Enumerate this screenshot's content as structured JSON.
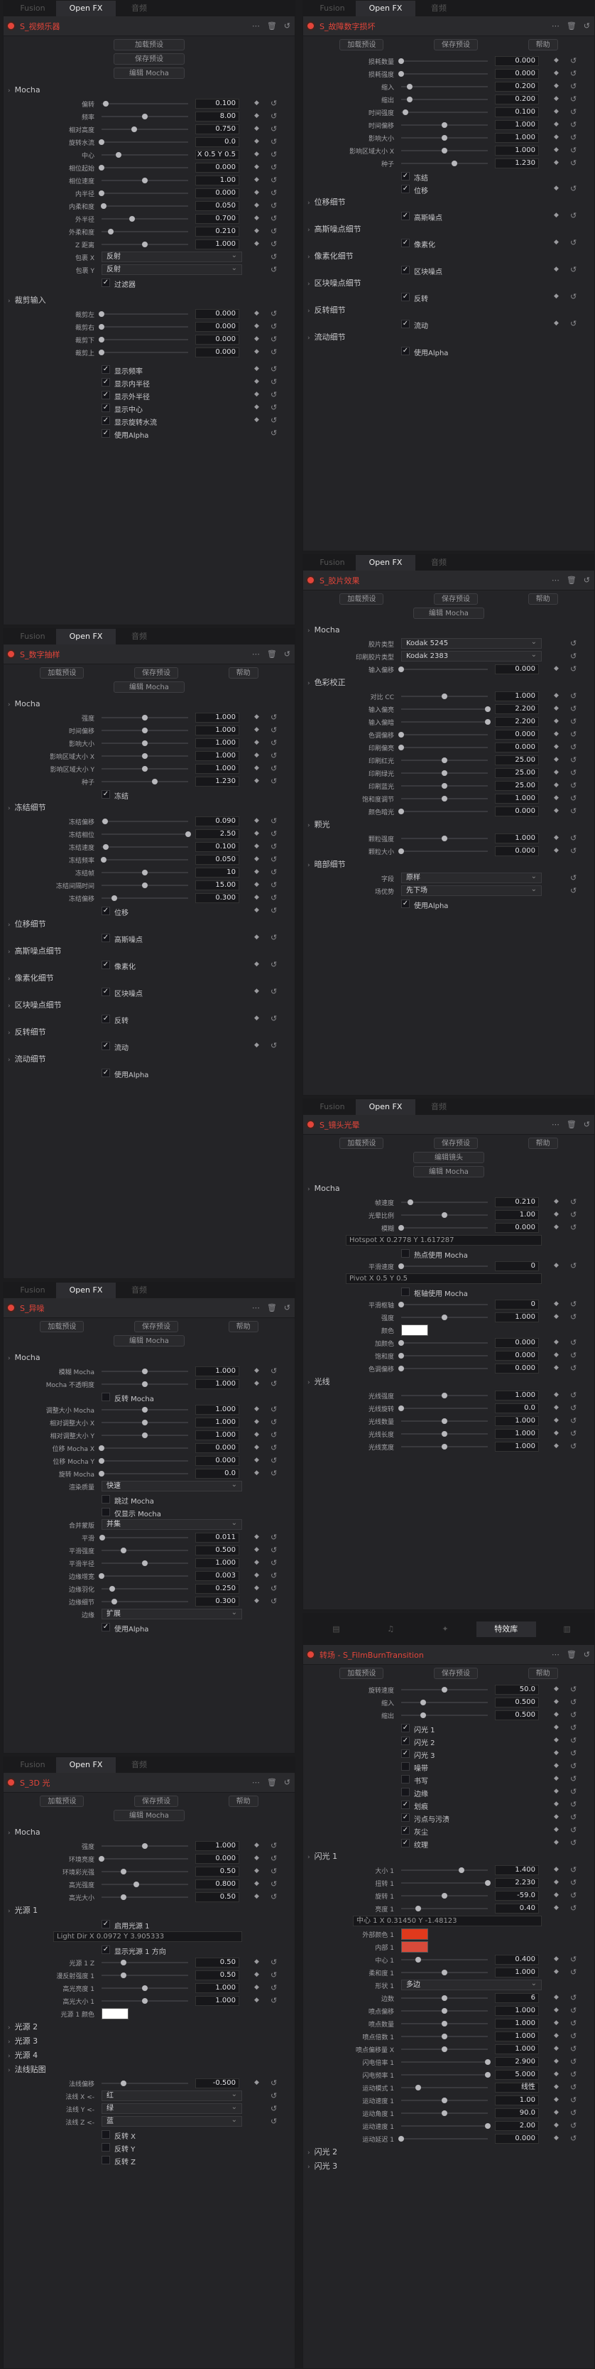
{
  "tab_fusion": "Fusion",
  "tab_openfx": "Open FX",
  "tab_other": "音频",
  "tab_effects": "特效库",
  "btn_load": "加载预设",
  "btn_save": "保存预设",
  "btn_help": "帮助",
  "btn_mocha": "编辑 Mocha",
  "btn_lens": "编辑镜头",
  "p1": {
    "title": "S_视频乐器",
    "secs": [
      "Mocha",
      "裁剪输入"
    ],
    "rows": [
      [
        "偏转",
        "0.100"
      ],
      [
        "频率",
        "8.00"
      ],
      [
        "相对高度",
        "0.750"
      ],
      [
        "旋转水流",
        "0.0"
      ],
      [
        "中心",
        "X 0.5   Y 0.5"
      ],
      [
        "相位起始",
        "0.000"
      ],
      [
        "相位速度",
        "1.00"
      ],
      [
        "内半径",
        "0.000"
      ],
      [
        "内柔和度",
        "0.050"
      ],
      [
        "外半径",
        "0.700"
      ],
      [
        "外柔和度",
        "0.210"
      ],
      [
        "Z 距离",
        "1.000"
      ]
    ],
    "drops": [
      [
        "包裹 X",
        "反射"
      ],
      [
        "包裹 Y",
        "反射"
      ]
    ],
    "filter": "过滤器",
    "crops": [
      [
        "裁剪左",
        "0.000"
      ],
      [
        "裁剪右",
        "0.000"
      ],
      [
        "裁剪下",
        "0.000"
      ],
      [
        "裁剪上",
        "0.000"
      ]
    ],
    "checks": [
      "显示频率",
      "显示内半径",
      "显示外半径",
      "显示中心",
      "显示旋转水流"
    ],
    "alpha": "使用Alpha"
  },
  "p2": {
    "title": "S_数字抽样",
    "rows": [
      [
        "强度",
        "1.000"
      ],
      [
        "时间偏移",
        "1.000"
      ],
      [
        "影响大小",
        "1.000"
      ],
      [
        "影响区域大小 X",
        "1.000"
      ],
      [
        "影响区域大小 Y",
        "1.000"
      ],
      [
        "种子",
        "1.230"
      ]
    ],
    "freeze": "冻结",
    "sec2": "冻结细节",
    "rows2": [
      [
        "冻结偏移",
        "0.090"
      ],
      [
        "冻结相位",
        "2.50"
      ],
      [
        "冻结速度",
        "0.100"
      ],
      [
        "冻结频率",
        "0.050"
      ],
      [
        "冻结帧",
        "10"
      ],
      [
        "冻结间隔时间",
        "15.00"
      ],
      [
        "冻结偏移",
        "0.300"
      ]
    ],
    "groups": [
      [
        "位移",
        "位移细节"
      ],
      [
        "高斯噪点",
        "高斯噪点细节"
      ],
      [
        "像素化",
        "像素化细节"
      ],
      [
        "区块噪点",
        "区块噪点细节"
      ],
      [
        "反转",
        "反转细节"
      ],
      [
        "流动",
        "流动细节"
      ]
    ],
    "alpha": "使用Alpha"
  },
  "p3": {
    "title": "S_异噪",
    "rows": [
      [
        "模糊 Mocha",
        "1.000"
      ],
      [
        "Mocha 不透明度",
        "1.000"
      ]
    ],
    "rev": "反转 Mocha",
    "rows2": [
      [
        "调整大小 Mocha",
        "1.000"
      ],
      [
        "相对调整大小 X",
        "1.000"
      ],
      [
        "相对调整大小 Y",
        "1.000"
      ],
      [
        "位移 Mocha X",
        "0.000"
      ],
      [
        "位移 Mocha Y",
        "0.000"
      ],
      [
        "旋转 Mocha",
        "0.0"
      ]
    ],
    "quality": [
      "渲染质量",
      "快速"
    ],
    "chk": [
      "跳过 Mocha",
      "仅显示 Mocha"
    ],
    "blend": [
      "合并蒙版",
      "并集"
    ],
    "rows3": [
      [
        "平滑",
        "0.011"
      ],
      [
        "平滑强度",
        "0.500"
      ],
      [
        "平滑半径",
        "1.000"
      ],
      [
        "边缘增宽",
        "0.003"
      ],
      [
        "边缘羽化",
        "0.250"
      ],
      [
        "边缘细节",
        "0.300"
      ]
    ],
    "edge": [
      "边缘",
      "扩展"
    ],
    "alpha": "使用Alpha"
  },
  "p4": {
    "title": "S_3D 光",
    "rows": [
      [
        "强度",
        "1.000"
      ],
      [
        "环境亮度",
        "0.000"
      ],
      [
        "环境彩光强",
        "0.50"
      ],
      [
        "高光强度",
        "0.800"
      ],
      [
        "高光大小",
        "0.50"
      ]
    ],
    "light": "光源 1",
    "enable": "启用光源 1",
    "dir": "Light Dir  X 0.0972   Y 3.905333",
    "show": "显示光源 1 方向",
    "rows2": [
      [
        "光源 1 Z",
        "0.50"
      ],
      [
        "漫反射强度 1",
        "0.50"
      ],
      [
        "高光亮度 1",
        "1.000"
      ],
      [
        "高光大小 1",
        "1.000"
      ]
    ],
    "color": "光源 1 颜色",
    "more": [
      "光源 2",
      "光源 3",
      "光源 4"
    ],
    "normal": "法线贴图",
    "nrows": [
      [
        "法线偏移",
        "-0.500"
      ]
    ],
    "ndd": [
      [
        "法线 X <-",
        "红"
      ],
      [
        "法线 Y <-",
        "绿"
      ],
      [
        "法线 Z <-",
        "蓝"
      ]
    ],
    "flips": [
      "反转 X",
      "反转 Y",
      "反转 Z"
    ]
  },
  "p5": {
    "title": "S_故障数字损坏",
    "rows": [
      [
        "损耗数量",
        "0.000"
      ],
      [
        "损耗强度",
        "0.000"
      ],
      [
        "缩入",
        "0.200"
      ],
      [
        "缩出",
        "0.200"
      ],
      [
        "时间强度",
        "0.100"
      ],
      [
        "时间偏移",
        "1.000"
      ],
      [
        "影响大小",
        "1.000"
      ],
      [
        "影响区域大小 X",
        "1.000"
      ],
      [
        "种子",
        "1.230"
      ]
    ],
    "freeze": "冻结",
    "groups": [
      [
        "位移",
        "位移细节"
      ],
      [
        "高斯噪点",
        "高斯噪点细节"
      ],
      [
        "像素化",
        "像素化细节"
      ],
      [
        "区块噪点",
        "区块噪点细节"
      ],
      [
        "反转",
        "反转细节"
      ],
      [
        "流动",
        "流动细节"
      ]
    ],
    "alpha": "使用Alpha"
  },
  "p6": {
    "title": "S_胶片效果",
    "dd": [
      [
        "胶片类型",
        "Kodak 5245"
      ],
      [
        "印刷胶片类型",
        "Kodak 2383"
      ]
    ],
    "rows": [
      [
        "输入偏移",
        "0.000"
      ]
    ],
    "sec": "色彩校正",
    "rows2": [
      [
        "对比 CC",
        "1.000"
      ],
      [
        "输入偏亮",
        "2.200"
      ],
      [
        "输入偏暗",
        "2.200"
      ],
      [
        "色调偏移",
        "0.000"
      ],
      [
        "印刷偏亮",
        "0.000"
      ],
      [
        "印刷红光",
        "25.00"
      ],
      [
        "印刷绿光",
        "25.00"
      ],
      [
        "印刷蓝光",
        "25.00"
      ],
      [
        "饱和度调节",
        "1.000"
      ],
      [
        "颜色暗光",
        "0.000"
      ]
    ],
    "halo": "颗光",
    "hrows": [
      [
        "颗粒强度",
        "1.000"
      ],
      [
        "颗粒大小",
        "0.000"
      ]
    ],
    "sec3": "暗部细节",
    "dd2": [
      [
        "字段",
        "原样"
      ],
      [
        "场优势",
        "先下场"
      ]
    ],
    "alpha": "使用Alpha"
  },
  "p7": {
    "title": "S_镜头光晕",
    "rows": [
      [
        "帧速度",
        "0.210"
      ],
      [
        "光晕比例",
        "1.00"
      ],
      [
        "模糊",
        "0.000"
      ]
    ],
    "hot": "Hotspot  X 0.2778   Y 1.617287",
    "hotchk": "热点使用 Mocha",
    "rows2": [
      [
        "平滑速度",
        "0"
      ]
    ],
    "pivot": "Pivot  X 0.5   Y 0.5",
    "pchk": "枢轴使用 Mocha",
    "rows3": [
      [
        "平滑枢轴",
        "0"
      ],
      [
        "强度",
        "1.000"
      ]
    ],
    "color": "颜色",
    "rows4": [
      [
        "加颜色",
        "0.000"
      ],
      [
        "饱和度",
        "0.000"
      ],
      [
        "色调偏移",
        "0.000"
      ]
    ],
    "sec": "光线",
    "rows5": [
      [
        "光线强度",
        "1.000"
      ],
      [
        "光线旋转",
        "0.0"
      ],
      [
        "光线数量",
        "1.000"
      ],
      [
        "光线长度",
        "1.000"
      ],
      [
        "光线宽度",
        "1.000"
      ]
    ]
  },
  "p8": {
    "title": "转场 - S_FilmBurnTransition",
    "rows": [
      [
        "旋转速度",
        "50.0"
      ],
      [
        "缩入",
        "0.500"
      ],
      [
        "缩出",
        "0.500"
      ]
    ],
    "checks": [
      "闪光 1",
      "闪光 2",
      "闪光 3",
      "噪带",
      "书写",
      "边缘",
      "划痕",
      "污点与污渍",
      "灰尘",
      "纹理"
    ],
    "checked": [
      true,
      true,
      true,
      false,
      false,
      false,
      true,
      true,
      true,
      true
    ],
    "sec": "闪光 1",
    "rows2": [
      [
        "大小 1",
        "1.400"
      ],
      [
        "扭转 1",
        "2.230"
      ],
      [
        "旋转 1",
        "-59.0"
      ],
      [
        "亮度 1",
        "0.40"
      ]
    ],
    "xy": "中心 1  X 0.31450   Y -1.48123",
    "colors": [
      [
        "外部颜色 1",
        "#e0391c"
      ],
      [
        "内部 1",
        "#d84a3a"
      ]
    ],
    "rows3": [
      [
        "中心 1",
        "0.400"
      ],
      [
        "柔和度 1",
        "1.000"
      ]
    ],
    "shape": [
      "形状 1",
      "多边"
    ],
    "rows4": [
      [
        "边数",
        "6"
      ],
      [
        "喷点偏移",
        "1.000"
      ],
      [
        "喷点数量",
        "1.000"
      ],
      [
        "喷点倍数 1",
        "1.000"
      ],
      [
        "喷点偏移量 X",
        "1.000"
      ],
      [
        "闪电倍率 1",
        "2.900"
      ],
      [
        "闪电频率 1",
        "5.000"
      ],
      [
        "运动模式 1",
        "线性"
      ],
      [
        "运动速度 1",
        "1.00"
      ],
      [
        "运动角度 1",
        "90.0"
      ],
      [
        "运动速度 1",
        "2.00"
      ],
      [
        "运动延迟 1",
        "0.000"
      ]
    ],
    "more": [
      "闪光 2",
      "闪光 3"
    ]
  }
}
